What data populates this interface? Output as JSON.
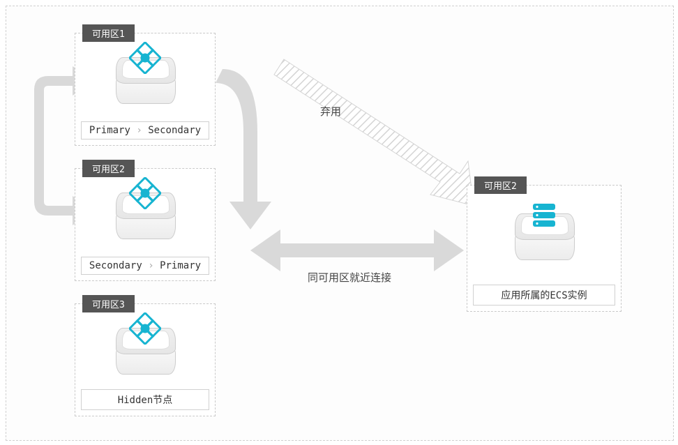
{
  "zones": {
    "z1": {
      "title": "可用区1",
      "label_a": "Primary",
      "label_b": "Secondary"
    },
    "z2": {
      "title": "可用区2",
      "label_a": "Secondary",
      "label_b": "Primary"
    },
    "z3": {
      "title": "可用区3",
      "label": "Hidden节点"
    },
    "ecs": {
      "title": "可用区2",
      "label": "应用所属的ECS实例"
    }
  },
  "arrows": {
    "deprecated": "弃用",
    "nearby": "同可用区就近连接"
  },
  "colors": {
    "accent": "#17b4d1",
    "arrow": "#d9d9d9",
    "hatch": "#d4d4d4",
    "tab": "#555555"
  }
}
